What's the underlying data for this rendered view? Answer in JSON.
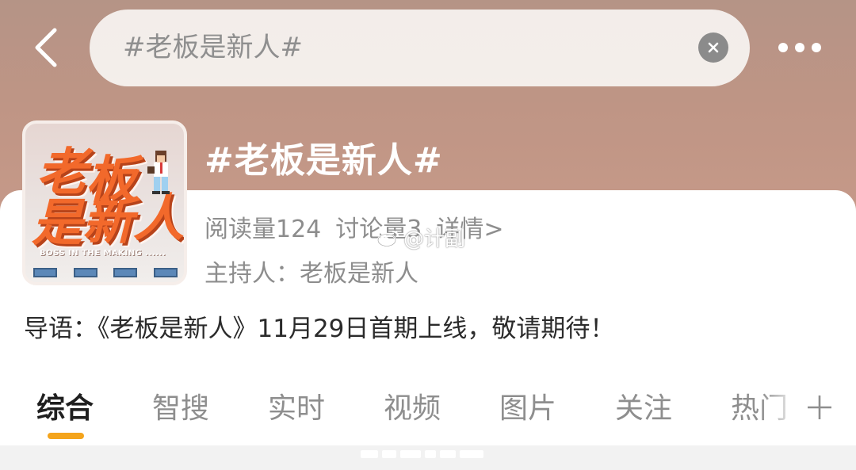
{
  "search": {
    "query": "#老板是新人#"
  },
  "topic": {
    "title": "#老板是新人#",
    "cover": {
      "title_chars": [
        "老",
        "板",
        "是",
        "新",
        "人"
      ],
      "subtitle": "BOSS IN THE MAKING ......"
    },
    "stats": {
      "reads": "阅读量124",
      "discussions": "讨论量3",
      "details": "详情>"
    },
    "host": "主持人：老板是新人",
    "intro": "导语：《老板是新人》11月29日首期上线，敬请期待！"
  },
  "watermark": "@计副",
  "tabs": [
    {
      "label": "综合",
      "active": true
    },
    {
      "label": "智搜",
      "active": false
    },
    {
      "label": "实时",
      "active": false
    },
    {
      "label": "视频",
      "active": false
    },
    {
      "label": "图片",
      "active": false
    },
    {
      "label": "关注",
      "active": false
    },
    {
      "label": "热门",
      "active": false
    }
  ],
  "icons": {
    "back": "chevron-left-icon",
    "clear": "close-circle-icon",
    "more": "more-dots-icon",
    "add_tab": "plus-icon"
  },
  "colors": {
    "accent": "#f4a41c",
    "header": "#c09586",
    "cover_text": "#f2692b"
  }
}
